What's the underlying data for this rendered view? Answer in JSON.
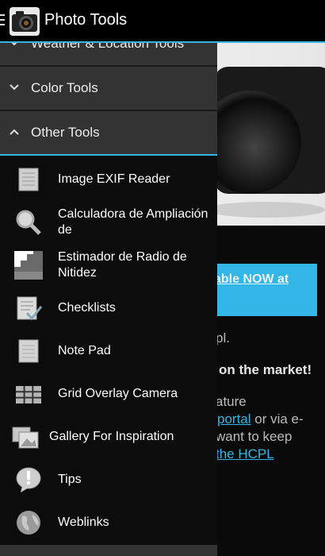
{
  "app": {
    "title": "Photo Tools"
  },
  "colors": {
    "accent": "#33b5e5",
    "drawer_bg": "#0c0c0c",
    "group_bg": "#333333"
  },
  "drawer": {
    "groups": [
      {
        "label": "Weather & Location Tools",
        "expanded": false
      },
      {
        "label": "Color Tools",
        "expanded": false
      },
      {
        "label": "Other Tools",
        "expanded": true
      }
    ],
    "items": [
      {
        "label": "Image EXIF Reader",
        "icon": "document-icon"
      },
      {
        "label": "Calculadora de Ampliación de",
        "icon": "magnifier-icon"
      },
      {
        "label": "Estimador de Radio de Nitidez",
        "icon": "sharpness-icon"
      },
      {
        "label": "Checklists",
        "icon": "checklist-icon"
      },
      {
        "label": "Note Pad",
        "icon": "notepad-icon"
      },
      {
        "label": "Grid Overlay Camera",
        "icon": "grid-icon"
      },
      {
        "label": "Gallery For Inspiration",
        "icon": "gallery-icon"
      },
      {
        "label": "Tips",
        "icon": "tips-icon"
      },
      {
        "label": "Weblinks",
        "icon": "globe-icon"
      }
    ]
  },
  "background": {
    "banner_text": "able NOW at",
    "lines": {
      "line1": "pl.",
      "line2": "on the market!",
      "line3": "ature",
      "line4_link": "portal",
      "line4_rest": " or via e-",
      "line5": "want to keep",
      "line6_link": "the HCPL"
    }
  }
}
